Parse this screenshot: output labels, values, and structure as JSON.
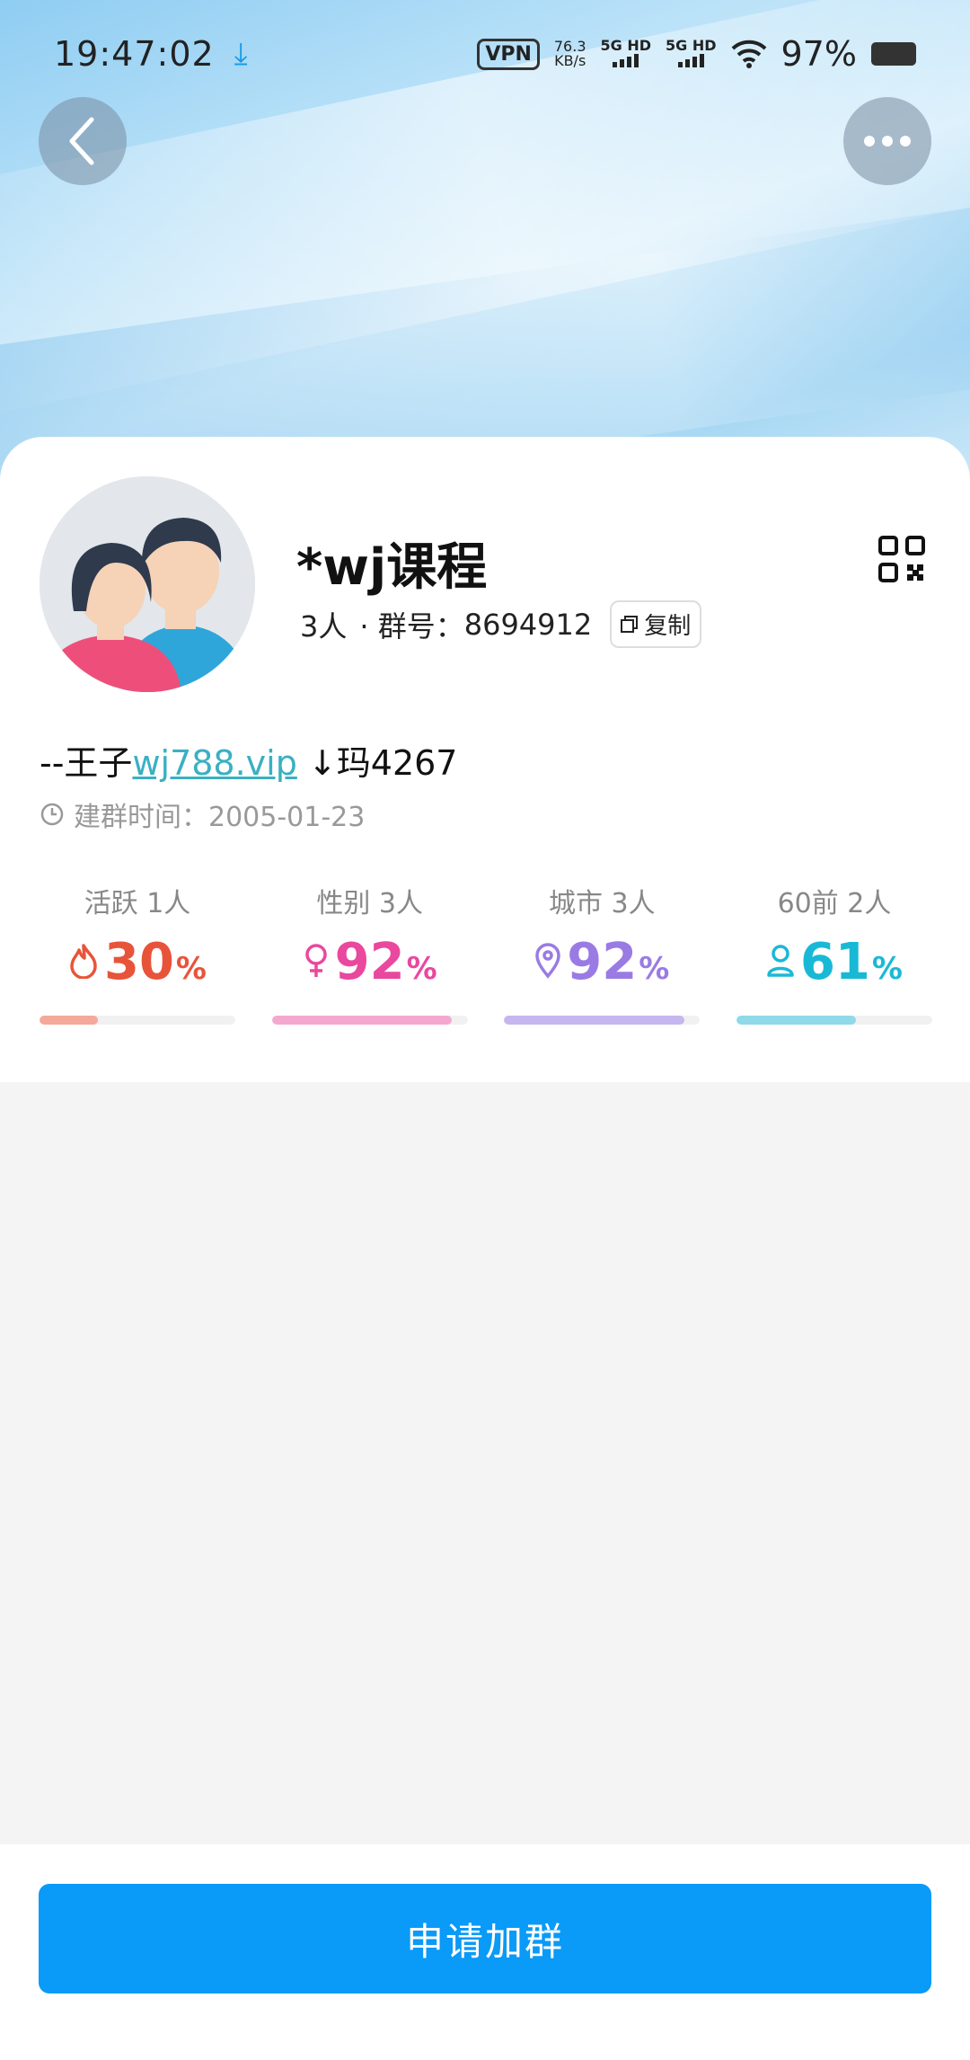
{
  "status_bar": {
    "time": "19:47:02",
    "vpn": "VPN",
    "net_speed_value": "76.3",
    "net_speed_unit": "KB/s",
    "sim1": "5G HD",
    "sim2": "5G HD",
    "battery": "97%"
  },
  "group": {
    "name": "*wj课程",
    "member_count": "3人",
    "id_label": "· 群号：",
    "id": "8694912",
    "copy_label": "复制",
    "description_prefix": "--王子",
    "description_link": "wj788.vip",
    "description_suffix": " ↓玛4267",
    "created_label": "建群时间：",
    "created_date": "2005-01-23"
  },
  "stats": [
    {
      "label": "活跃 1人",
      "value": "30",
      "unit": "%",
      "icon": "flame-icon",
      "percent": 30,
      "color": "#e8543a",
      "bar_color": "#f4a99a"
    },
    {
      "label": "性别 3人",
      "value": "92",
      "unit": "%",
      "icon": "female-icon",
      "percent": 92,
      "color": "#e9489e",
      "bar_color": "#f4a8cf"
    },
    {
      "label": "城市 3人",
      "value": "92",
      "unit": "%",
      "icon": "location-icon",
      "percent": 92,
      "color": "#9a7be3",
      "bar_color": "#c6b6ef"
    },
    {
      "label": "60前 2人",
      "value": "61",
      "unit": "%",
      "icon": "person-icon",
      "percent": 61,
      "color": "#19b9d6",
      "bar_color": "#8fd9e8"
    }
  ],
  "actions": {
    "apply_label": "申请加群"
  }
}
